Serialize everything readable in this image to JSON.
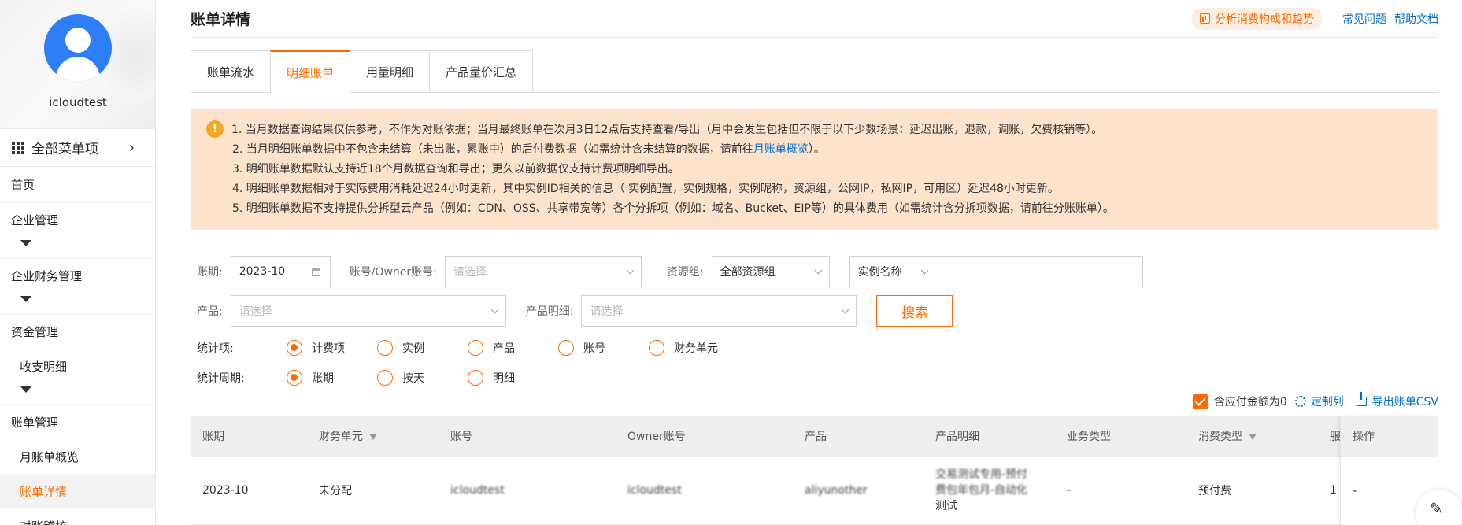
{
  "sidebar": {
    "username": "icloudtest",
    "menu_all": "全部菜单项",
    "items": [
      {
        "label": "首页"
      },
      {
        "label": "企业管理"
      },
      {
        "label": "企业财务管理"
      },
      {
        "label": "资金管理"
      },
      {
        "label": "收支明细"
      },
      {
        "label": "账单管理"
      },
      {
        "label": "月账单概览"
      },
      {
        "label": "账单详情"
      },
      {
        "label": "对账稽核"
      }
    ]
  },
  "header": {
    "title": "账单详情",
    "analyze": "分析消费构成和趋势",
    "faq": "常见问题",
    "help": "帮助文档"
  },
  "tabs": [
    "账单流水",
    "明细账单",
    "用量明细",
    "产品量价汇总"
  ],
  "notice": {
    "line1": "1. 当月数据查询结果仅供参考，不作为对账依据；当月最终账单在次月3日12点后支持查看/导出（月中会发生包括但不限于以下少数场景：延迟出账，退款，调账，欠费核销等）。",
    "line2_before": "2. 当月明细账单数据中不包含未结算（未出账，累账中）的后付费数据（如需统计含未结算的数据，请前往",
    "line2_link": "月账单概览",
    "line2_after": "）。",
    "line3": "3. 明细账单数据默认支持近18个月数据查询和导出；更久以前数据仅支持计费项明细导出。",
    "line4": "4. 明细账单数据相对于实际费用消耗延迟24小时更新，其中实例ID相关的信息（ 实例配置，实例规格，实例昵称，资源组，公网IP，私网IP，可用区）延迟48小时更新。",
    "line5": "5. 明细账单数据不支持提供分拆型云产品（例如：CDN、OSS、共享带宽等）各个分拆项（例如：域名、Bucket、EIP等）的具体费用（如需统计含分拆项数据，请前往分账账单）。"
  },
  "filters": {
    "period_label": "账期:",
    "period_value": "2023-10",
    "account_label": "账号/Owner账号:",
    "account_placeholder": "请选择",
    "rg_label": "资源组:",
    "rg_value": "全部资源组",
    "instance_select": "实例名称",
    "product_label": "产品:",
    "product_placeholder": "请选择",
    "detail_label": "产品明细:",
    "detail_placeholder": "请选择",
    "search": "搜索"
  },
  "stat_items": {
    "label": "统计项:",
    "options": [
      "计费项",
      "实例",
      "产品",
      "账号",
      "财务单元"
    ],
    "selected": "计费项"
  },
  "stat_period": {
    "label": "统计周期:",
    "options": [
      "账期",
      "按天",
      "明细"
    ],
    "selected": "账期"
  },
  "toolbar": {
    "zero_checkbox": "含应付金额为0",
    "customize": "定制列",
    "export": "导出账单CSV"
  },
  "table": {
    "headers": [
      "账期",
      "财务单元",
      "账号",
      "Owner账号",
      "产品",
      "产品明细",
      "业务类型",
      "消费类型",
      "服",
      "操作"
    ],
    "row": {
      "period": "2023-10",
      "finance_unit": "未分配",
      "account": "icloudtest",
      "owner": "icloudtest",
      "product": "aliyunother",
      "detail_line1": "交易测试专用-预付",
      "detail_line2": "费包年包月-自动化",
      "detail_line3": "测试",
      "biz_type": "-",
      "consume_type": "预付费",
      "service": "1",
      "op": "-"
    }
  },
  "colors": {
    "accent": "#ff6a00",
    "link": "#0070cc",
    "notice_bg": "#fde2cc"
  }
}
